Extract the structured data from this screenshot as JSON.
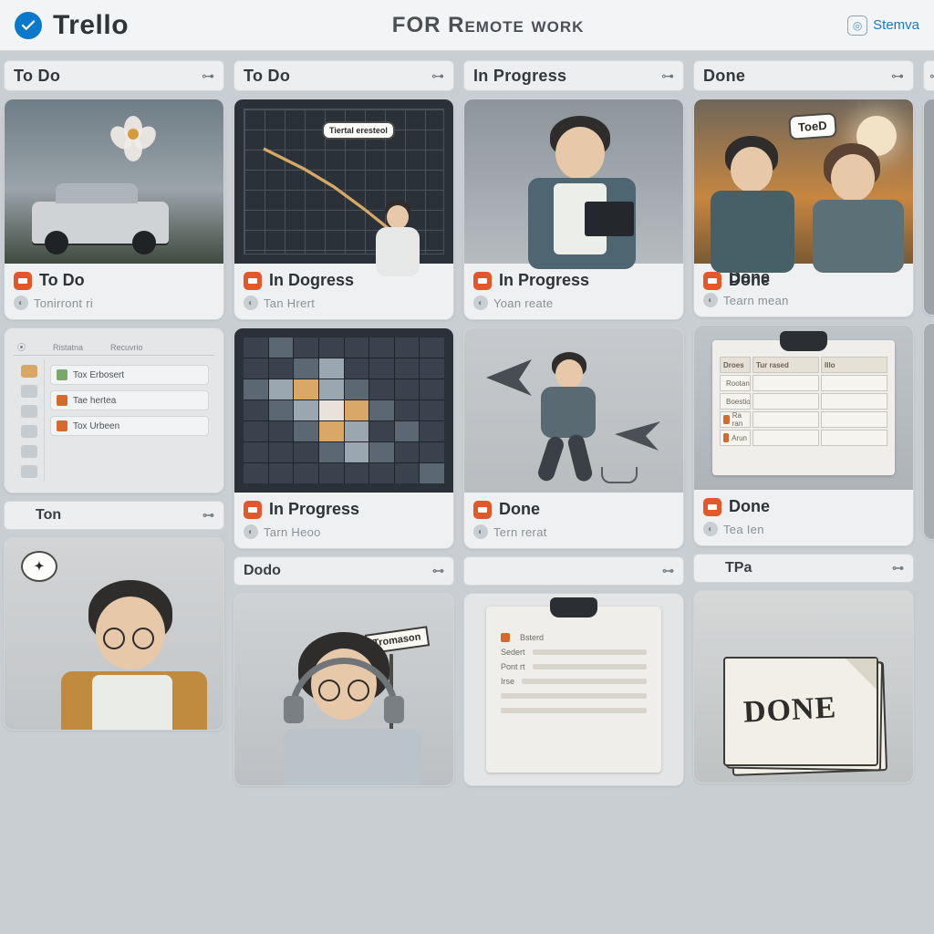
{
  "header": {
    "app_name": "Trello",
    "title": "FOR Remote work",
    "right_label": "Stemva"
  },
  "columns": [
    {
      "header": "To Do",
      "cards": [
        {
          "title": "To Do",
          "subtitle": "Tonirront ri",
          "cover": "car-flower"
        },
        {
          "title": "",
          "subtitle": "",
          "cover": "mini-list",
          "list_headers": [
            "Ristatna",
            "Recuvrio"
          ],
          "list_items": [
            "Tox Erbosert",
            "Tae hertea",
            "Tox Urbeen"
          ]
        }
      ],
      "mini_header": "Ton",
      "tail_card": {
        "cover": "man-glasses"
      }
    },
    {
      "header": "To Do",
      "cards": [
        {
          "title": "In Dogress",
          "subtitle": "Tan Hrert",
          "cover": "grid-person",
          "tooltip": "Tiertal eresteol"
        },
        {
          "title": "In Progress",
          "subtitle": "Tarn Heoo",
          "cover": "heatmap"
        }
      ],
      "mini_header": "Dodo",
      "tail_card": {
        "cover": "headphones",
        "sign": "Tromason"
      }
    },
    {
      "header": "In Progress",
      "cards": [
        {
          "title": "In Progress",
          "subtitle": "Yoan reate",
          "cover": "laptop-guy"
        },
        {
          "title": "Done",
          "subtitle": "Tern rerat",
          "cover": "walking-birds"
        }
      ],
      "mini_header": "",
      "tail_card": {
        "cover": "clipboard-list",
        "proj_rows": [
          "Bsterd",
          "Sedert",
          "Pont rt",
          "Irse"
        ]
      }
    },
    {
      "header": "Done",
      "cards": [
        {
          "title": "Done",
          "subtitle": "Tearn mean",
          "cover": "duo-sunset",
          "sign": "ToeD"
        },
        {
          "title": "Done",
          "subtitle": "Tea Ien",
          "cover": "clipboard-table",
          "table_headers": [
            "Droes",
            "Tur rased",
            "Illo"
          ],
          "table_rows": [
            "Rootant",
            "Boestion",
            "Ra ran",
            "Arun"
          ]
        }
      ],
      "mini_header": "TPa",
      "tail_card": {
        "cover": "done-stack",
        "stack_label": "DONE"
      }
    }
  ],
  "colors": {
    "accent": "#e2582b",
    "brand": "#0a79c9"
  }
}
